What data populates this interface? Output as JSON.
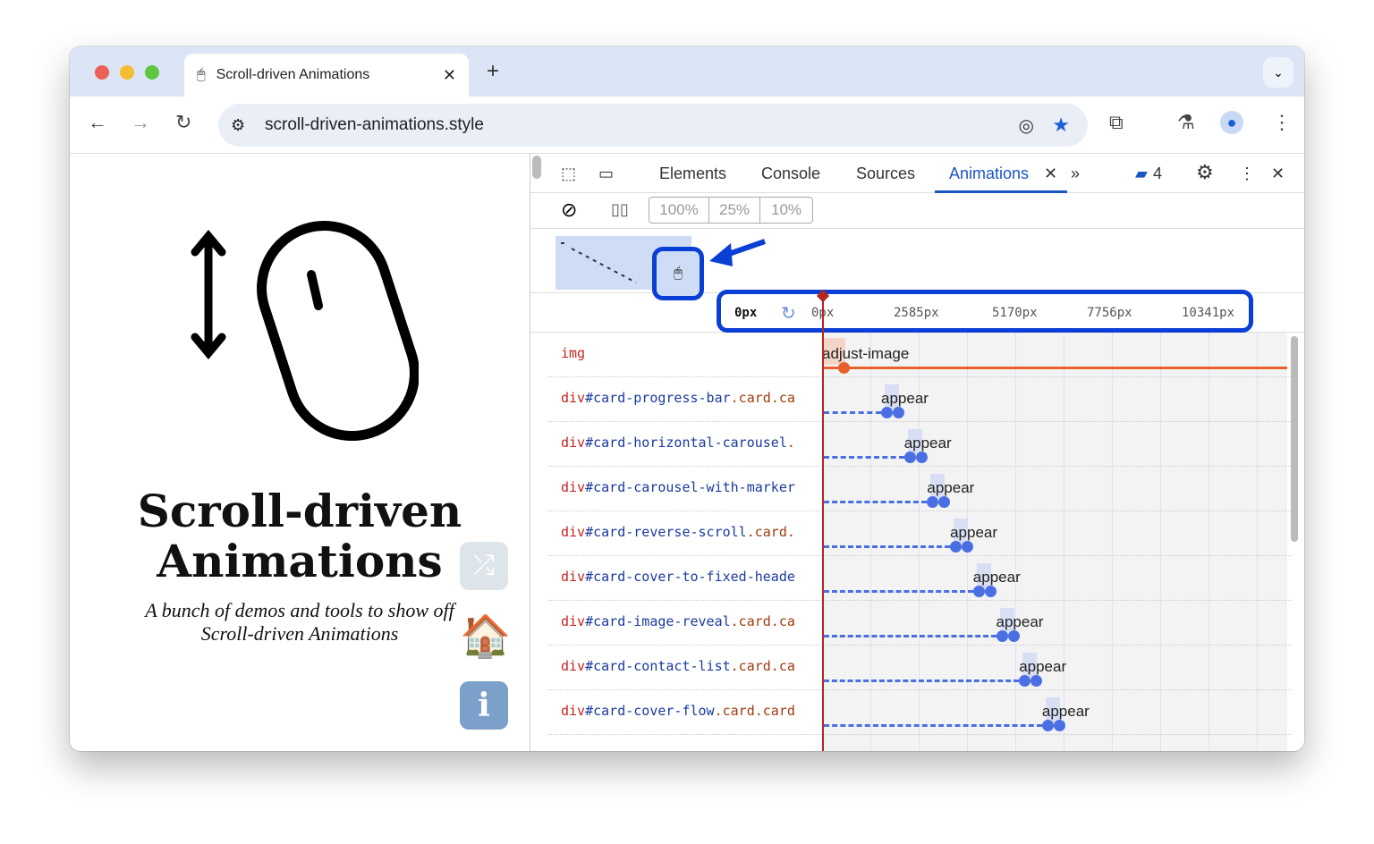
{
  "browser": {
    "tab_title": "Scroll-driven Animations",
    "url": "scroll-driven-animations.style"
  },
  "page": {
    "title_line1": "Scroll-driven",
    "title_line2": "Animations",
    "subtitle_line1": "A bunch of demos and tools to show off",
    "subtitle_line2": "Scroll-driven Animations"
  },
  "devtools": {
    "tabs": [
      "Elements",
      "Console",
      "Sources",
      "Animations"
    ],
    "active_tab": "Animations",
    "issues_count": "4",
    "speeds": [
      "100%",
      "25%",
      "10%"
    ],
    "current_position": "0px",
    "ruler_ticks": [
      "0px",
      "2585px",
      "5170px",
      "7756px",
      "10341px"
    ],
    "rows": [
      {
        "tag": "img",
        "id": "",
        "cls": "",
        "anim": "adjust-image",
        "color": "#e8602c"
      },
      {
        "tag": "div",
        "id": "#card-progress-bar",
        "cls": ".card.ca",
        "anim": "appear",
        "color": "#4a6fe3"
      },
      {
        "tag": "div",
        "id": "#card-horizontal-carousel",
        "cls": ".",
        "anim": "appear",
        "color": "#4a6fe3"
      },
      {
        "tag": "div",
        "id": "#card-carousel-with-marker",
        "cls": "",
        "anim": "appear",
        "color": "#4a6fe3"
      },
      {
        "tag": "div",
        "id": "#card-reverse-scroll",
        "cls": ".card.",
        "anim": "appear",
        "color": "#4a6fe3"
      },
      {
        "tag": "div",
        "id": "#card-cover-to-fixed-heade",
        "cls": "",
        "anim": "appear",
        "color": "#4a6fe3"
      },
      {
        "tag": "div",
        "id": "#card-image-reveal",
        "cls": ".card.ca",
        "anim": "appear",
        "color": "#4a6fe3"
      },
      {
        "tag": "div",
        "id": "#card-contact-list",
        "cls": ".card.ca",
        "anim": "appear",
        "color": "#4a6fe3"
      },
      {
        "tag": "div",
        "id": "#card-cover-flow",
        "cls": ".card.card",
        "anim": "appear",
        "color": "#4a6fe3"
      }
    ]
  }
}
